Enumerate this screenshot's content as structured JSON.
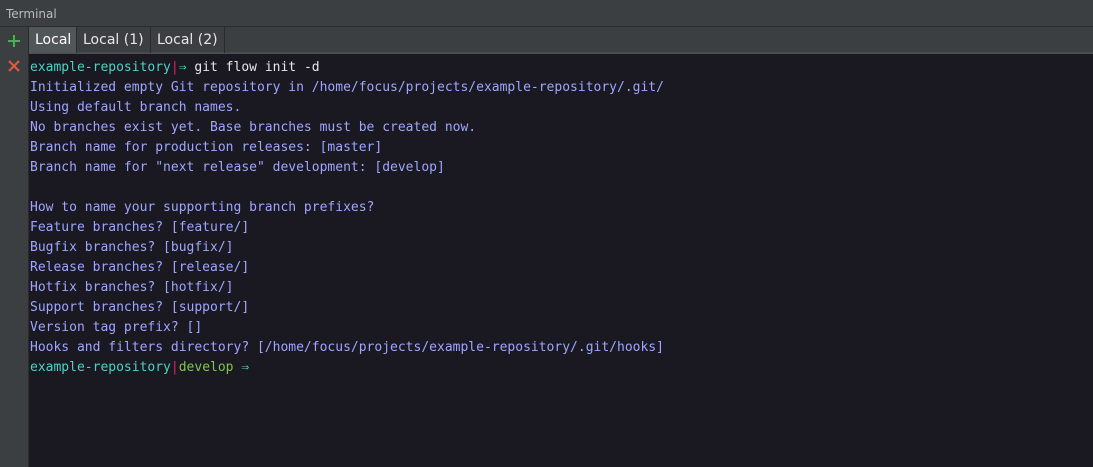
{
  "window": {
    "title": "Terminal"
  },
  "toolbar": {
    "new_icon": "plus-icon",
    "close_icon": "close-icon",
    "new_color": "#4caf50",
    "close_color": "#e05a3c"
  },
  "tabs": [
    {
      "label": "Local",
      "active": true
    },
    {
      "label": "Local (1)",
      "active": false
    },
    {
      "label": "Local (2)",
      "active": false
    }
  ],
  "terminal": {
    "prompt1": {
      "dir": "example-repository",
      "sep": "|",
      "arrow": "⇒",
      "command": " git flow init -d"
    },
    "output": [
      "Initialized empty Git repository in /home/focus/projects/example-repository/.git/",
      "Using default branch names.",
      "No branches exist yet. Base branches must be created now.",
      "Branch name for production releases: [master]",
      "Branch name for \"next release\" development: [develop]",
      "",
      "How to name your supporting branch prefixes?",
      "Feature branches? [feature/]",
      "Bugfix branches? [bugfix/]",
      "Release branches? [release/]",
      "Hotfix branches? [hotfix/]",
      "Support branches? [support/]",
      "Version tag prefix? []",
      "Hooks and filters directory? [/home/focus/projects/example-repository/.git/hooks]"
    ],
    "prompt2": {
      "dir": "example-repository",
      "sep": "|",
      "branch": "develop",
      "arrow": "⇒"
    }
  }
}
